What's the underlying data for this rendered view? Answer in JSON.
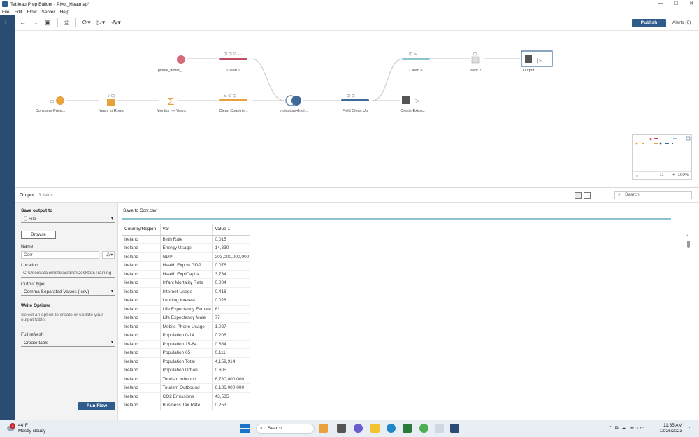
{
  "window": {
    "title": "Tableau Prep Builder - Pivot_Heatmap*",
    "controls": [
      "—",
      "☐",
      "✕"
    ]
  },
  "menu": [
    "File",
    "Edit",
    "Flow",
    "Server",
    "Help"
  ],
  "toolbar": {
    "publish_label": "Publish",
    "alerts_label": "Alerts (0)"
  },
  "flow": {
    "nodes": [
      {
        "id": "global",
        "label": "global_world_..."
      },
      {
        "id": "clean1",
        "label": "Clean 1"
      },
      {
        "id": "consumer",
        "label": "ConsumerPrice..."
      },
      {
        "id": "years",
        "label": "Years to Rows"
      },
      {
        "id": "months",
        "label": "Months --> Years"
      },
      {
        "id": "cleancountries",
        "label": "Clean Countrie..."
      },
      {
        "id": "join",
        "label": "Indicators+Indi..."
      },
      {
        "id": "fieldclean",
        "label": "Field Clean Up"
      },
      {
        "id": "clean5",
        "label": "Clean 5"
      },
      {
        "id": "pivot2",
        "label": "Pivot 2"
      },
      {
        "id": "output",
        "label": "Output"
      },
      {
        "id": "extract",
        "label": "Create Extract"
      }
    ],
    "zoom": "100%"
  },
  "panel": {
    "title": "Output",
    "field_count": "3 fields",
    "search_placeholder": "Search"
  },
  "settings": {
    "save_output_to_label": "Save output to",
    "save_output_to_value": "File",
    "browse_label": "Browse",
    "name_label": "Name",
    "name_value": "Corr",
    "location_label": "Location",
    "location_value": "C:\\Users\\SalomeGrasland\\Desktop\\Training",
    "output_type_label": "Output type",
    "output_type_value": "Comma Separated Values (.csv)",
    "write_options_label": "Write Options",
    "write_options_help": "Select an option to create or update your output table.",
    "full_refresh_label": "Full refresh",
    "full_refresh_value": "Create table",
    "run_flow_label": "Run Flow"
  },
  "grid": {
    "title": "Save to Corr.csv",
    "headers": [
      "Country/Region",
      "Var",
      "Value 1"
    ],
    "rows": [
      [
        "Ireland",
        "Birth Rate",
        "0.015"
      ],
      [
        "Ireland",
        "Energy Usage",
        "14,330"
      ],
      [
        "Ireland",
        "GDP",
        "203,000,000,000"
      ],
      [
        "Ireland",
        "Health Exp % GDP",
        "0.076"
      ],
      [
        "Ireland",
        "Health Exp/Capita",
        "3,734"
      ],
      [
        "Ireland",
        "Infant Mortality Rate",
        "0.004"
      ],
      [
        "Ireland",
        "Internet Usage",
        "0.416"
      ],
      [
        "Ireland",
        "Lending Interest",
        "0.026"
      ],
      [
        "Ireland",
        "Life Expectancy Female",
        "81"
      ],
      [
        "Ireland",
        "Life Expectancy Male",
        "77"
      ],
      [
        "Ireland",
        "Mobile Phone Usage",
        "1.027"
      ],
      [
        "Ireland",
        "Population 0-14",
        "0.206"
      ],
      [
        "Ireland",
        "Population 15-64",
        "0.684"
      ],
      [
        "Ireland",
        "Population 65+",
        "0.111"
      ],
      [
        "Ireland",
        "Population Total",
        "4,159,914"
      ],
      [
        "Ireland",
        "Population Urban",
        "0.605"
      ],
      [
        "Ireland",
        "Tourism Inbound",
        "6,780,000,000"
      ],
      [
        "Ireland",
        "Tourism Outbound",
        "6,186,000,000"
      ],
      [
        "Ireland",
        "CO2 Emissions",
        "43,535"
      ],
      [
        "Ireland",
        "Business Tax Rate",
        "0.253"
      ]
    ]
  },
  "taskbar": {
    "weather_temp": "44°F",
    "weather_desc": "Mostly cloudy",
    "search_label": "Search",
    "time": "11:35 AM",
    "date": "12/26/2023",
    "notification_count": "1"
  }
}
